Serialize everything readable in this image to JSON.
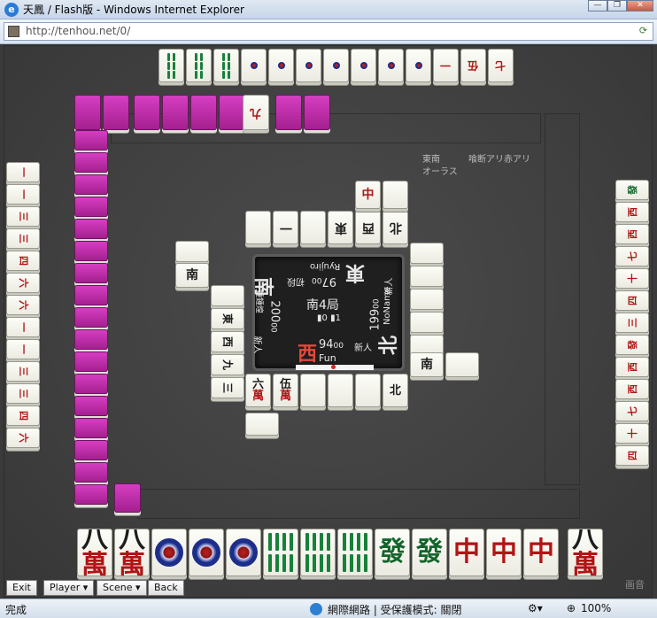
{
  "window": {
    "title": "天鳳 / Flash版 - Windows Internet Explorer",
    "url": "http://tenhou.net/0/",
    "buttons": [
      "—",
      "❐",
      "✕"
    ]
  },
  "game": {
    "rules": "東南",
    "rules_detail": "喰断アリ赤アリ",
    "round_phase": "オーラス",
    "round": "南4局",
    "honba": "0",
    "riichi_sticks": "1",
    "players": {
      "bottom": {
        "name": "Fun",
        "wind": "西",
        "score": "94",
        "score_suffix": "00",
        "rank": "新人"
      },
      "right": {
        "name": "NoName",
        "wind": "北",
        "score": "199",
        "score_suffix": "00",
        "rank": "新人"
      },
      "top": {
        "name": "Ryujiro",
        "wind": "東",
        "score": "97",
        "score_suffix": "00",
        "rank": "初段"
      },
      "left": {
        "name": "鍾鍾煌",
        "wind": "南",
        "score": "200",
        "score_suffix": "00",
        "rank": "新人"
      }
    },
    "hand": [
      {
        "name": "8-man",
        "a": "八",
        "b": "萬"
      },
      {
        "name": "8-man",
        "a": "八",
        "b": "萬"
      },
      {
        "name": "1-pin"
      },
      {
        "name": "1-pin"
      },
      {
        "name": "1-pin"
      },
      {
        "name": "8-sou"
      },
      {
        "name": "8-sou"
      },
      {
        "name": "8-sou"
      },
      {
        "name": "hatsu",
        "a": "發"
      },
      {
        "name": "hatsu",
        "a": "發"
      },
      {
        "name": "chun",
        "a": "中"
      },
      {
        "name": "chun",
        "a": "中"
      },
      {
        "name": "chun",
        "a": "中"
      }
    ],
    "drawn_tile": {
      "name": "8-man",
      "a": "八",
      "b": "萬"
    },
    "bottom_discards": [
      {
        "a": "六",
        "b": "萬"
      },
      {
        "a": "伍",
        "b": "萬"
      },
      {
        "a": "",
        "b": ""
      },
      {
        "a": "",
        "b": ""
      },
      {
        "a": "",
        "b": ""
      },
      {
        "a": "北",
        "b": ""
      }
    ],
    "top_meld_labels": [
      "一",
      "伍",
      "七"
    ],
    "left_hand": [
      "一",
      "一",
      "三",
      "三",
      "四",
      "六",
      "六"
    ],
    "right_hand": [
      "發",
      "西",
      "西",
      "七",
      "十",
      "四",
      "三"
    ]
  },
  "controls": {
    "exit": "Exit",
    "player": "Player ▾",
    "scene": "Scene ▾",
    "back": "Back",
    "logo": "画音"
  },
  "status": {
    "done": "完成",
    "zone": "網際網路 | 受保護模式: 關閉",
    "zoom": "100%"
  }
}
